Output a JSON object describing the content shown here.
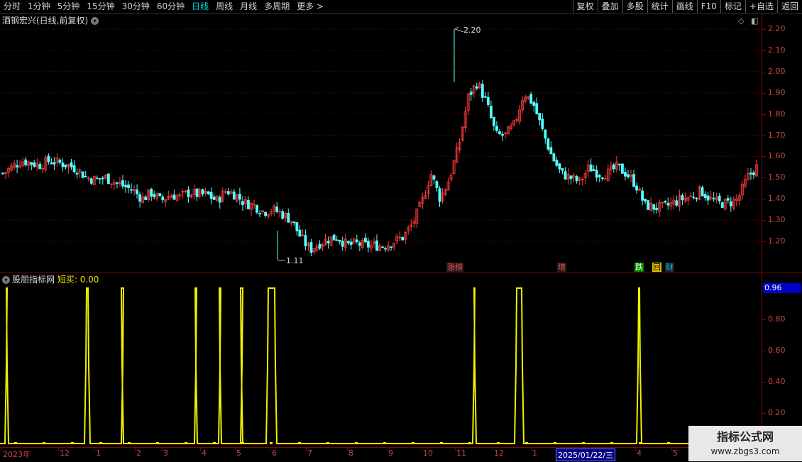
{
  "toolbar": {
    "tabs": [
      "分时",
      "1分钟",
      "5分钟",
      "15分钟",
      "30分钟",
      "60分钟",
      "日线",
      "周线",
      "月线",
      "多周期",
      "更多 >"
    ],
    "active_tab": "日线",
    "buttons": [
      "复权",
      "叠加",
      "多股",
      "统计",
      "画线",
      "F10",
      "标记",
      "+自选",
      "返回"
    ]
  },
  "price_panel": {
    "title": "酒钢宏兴(日线,前复权)",
    "axis_ticks": [
      "2.20",
      "2.10",
      "2.00",
      "1.90",
      "1.80",
      "1.70",
      "1.60",
      "1.50",
      "1.40",
      "1.30",
      "1.20"
    ],
    "high_label": "2.20",
    "low_label": "1.11",
    "badges": [
      {
        "text": "涨榜",
        "color": "#ff4040",
        "bg": "#202020"
      },
      {
        "text": "增",
        "color": "#ff4040",
        "bg": "#202020"
      },
      {
        "text": "跌",
        "color": "#ffffff",
        "bg": "#008800"
      },
      {
        "text": "回",
        "color": "#000000",
        "bg": "#e8c000"
      },
      {
        "text": "财",
        "color": "#00c0ff",
        "bg": "#202020"
      }
    ]
  },
  "indicator_panel": {
    "name": "股朋指标网",
    "short_label": "短买:",
    "short_value": "0.00",
    "current_value": "0.96",
    "axis_ticks": [
      "0.80",
      "0.60",
      "0.40",
      "0.20"
    ]
  },
  "date_axis": {
    "labels": [
      "2023年",
      "12",
      "1",
      "2",
      "3",
      "4",
      "5",
      "6",
      "7",
      "8",
      "9",
      "10",
      "11",
      "12",
      "1",
      "4",
      "5"
    ],
    "cursor_date": "2025/01/22/三"
  },
  "watermark": {
    "line1": "指标公式网",
    "line2": "www.zbgs3.com"
  },
  "colors": {
    "up": "#ff3c3c",
    "down": "#54ffff",
    "indicator": "#f0f000",
    "grid": "#8a0000"
  },
  "chart_data": {
    "type": "candlestick+line",
    "price_range": [
      1.11,
      2.2
    ],
    "indicator_range": [
      0,
      1
    ],
    "close_path": [
      1.52,
      1.55,
      1.58,
      1.57,
      1.56,
      1.58,
      1.57,
      1.56,
      1.54,
      1.5,
      1.49,
      1.5,
      1.48,
      1.46,
      1.44,
      1.4,
      1.43,
      1.39,
      1.42,
      1.41,
      1.43,
      1.42,
      1.42,
      1.39,
      1.44,
      1.42,
      1.38,
      1.37,
      1.34,
      1.35,
      1.33,
      1.3,
      1.22,
      1.16,
      1.19,
      1.21,
      1.22,
      1.18,
      1.19,
      1.18,
      1.18,
      1.18,
      1.2,
      1.22,
      1.28,
      1.38,
      1.52,
      1.4,
      1.5,
      1.65,
      1.88,
      1.95,
      1.85,
      1.7,
      1.7,
      1.75,
      1.9,
      1.85,
      1.72,
      1.6,
      1.52,
      1.5,
      1.48,
      1.55,
      1.52,
      1.52,
      1.55,
      1.52,
      1.47,
      1.37,
      1.36,
      1.36,
      1.38,
      1.4,
      1.41,
      1.44,
      1.4,
      1.38,
      1.38,
      1.4,
      1.5,
      1.55
    ],
    "indicator_spikes": [
      1,
      2,
      3,
      5,
      6,
      7,
      8,
      14,
      15,
      20
    ]
  }
}
